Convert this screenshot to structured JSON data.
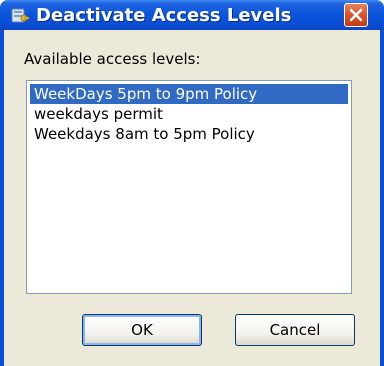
{
  "window": {
    "title": "Deactivate Access Levels",
    "icon": "key-icon"
  },
  "dialog": {
    "list_label": "Available access levels:",
    "items": [
      {
        "label": "WeekDays 5pm to 9pm Policy",
        "selected": true
      },
      {
        "label": "weekdays permit",
        "selected": false
      },
      {
        "label": "Weekdays 8am to 5pm Policy",
        "selected": false
      }
    ]
  },
  "buttons": {
    "ok_label": "OK",
    "cancel_label": "Cancel"
  },
  "colors": {
    "titlebar": "#0a54dc",
    "selection": "#316ac5",
    "client": "#ece9d8"
  }
}
